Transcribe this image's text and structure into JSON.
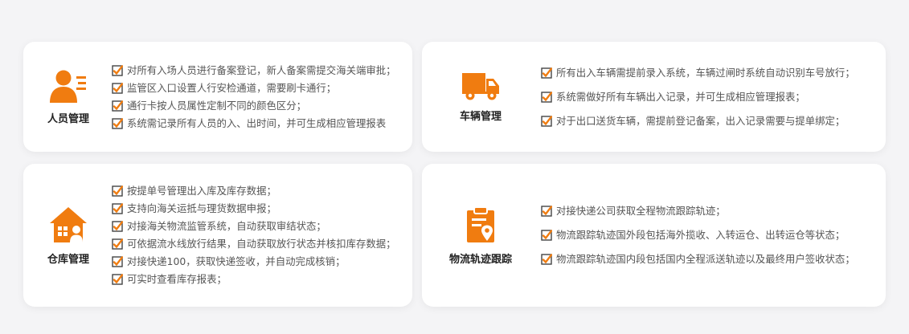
{
  "colors": {
    "accent": "#f07c10",
    "check_border": "#444444",
    "card_bg": "#ffffff",
    "page_bg": "#f4f4f6"
  },
  "cards": [
    {
      "title": "人员管理",
      "icon": "person-id-icon",
      "items": [
        "对所有入场人员进行备案登记，新人备案需提交海关端审批；",
        "监管区入口设置人行安检通道，需要刷卡通行；",
        "通行卡按人员属性定制不同的颜色区分；",
        "系统需记录所有人员的入、出时间，并可生成相应管理报表"
      ]
    },
    {
      "title": "车辆管理",
      "icon": "truck-icon",
      "items": [
        "所有出入车辆需提前录入系统，车辆过闸时系统自动识别车号放行；",
        "系统需做好所有车辆出入记录，并可生成相应管理报表；",
        "对于出口送货车辆，需提前登记备案，出入记录需要与提单绑定；"
      ]
    },
    {
      "title": "仓库管理",
      "icon": "warehouse-icon",
      "items": [
        "按提单号管理出入库及库存数据；",
        "支持向海关运抵与理货数据申报；",
        "对接海关物流监管系统，自动获取审结状态；",
        "可依据流水线放行结果，自动获取放行状态并核扣库存数据；",
        "对接快递100，获取快递签收，并自动完成核销；",
        "可实时查看库存报表；"
      ]
    },
    {
      "title": "物流轨迹跟踪",
      "icon": "location-clipboard-icon",
      "items": [
        "对接快递公司获取全程物流跟踪轨迹；",
        "物流跟踪轨迹国外段包括海外揽收、入转运仓、出转运仓等状态；",
        "物流跟踪轨迹国内段包括国内全程派送轨迹以及最终用户签收状态；"
      ]
    }
  ]
}
